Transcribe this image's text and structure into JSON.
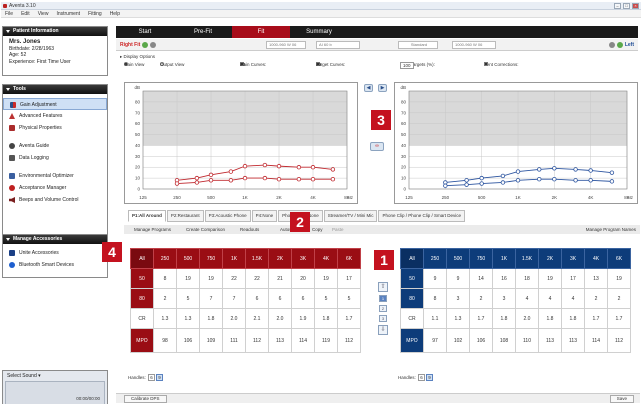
{
  "window": {
    "title": "Aventa 3.10"
  },
  "menu": [
    "File",
    "Edit",
    "View",
    "Instrument",
    "Fitting",
    "Help"
  ],
  "patient": {
    "header": "Patient Information",
    "name": "Mrs. Jones",
    "birthdate": "Birthdate: 2/28/1963",
    "age": "Age: 52",
    "experience": "Experience: First Time User"
  },
  "tools": {
    "header": "Tools",
    "items": [
      "Gain Adjustment",
      "Advanced Features",
      "Physical Properties",
      "Aventa Guide",
      "Data Logging",
      "Environmental Optimizer",
      "Acceptance Manager",
      "Beeps and Volume Control"
    ]
  },
  "accessories": {
    "header": "Manage Accessories",
    "items": [
      "Unite Accessories",
      "Bluetooth Smart Devices"
    ]
  },
  "sound": {
    "label": "Select Sound",
    "time": "00:00/00:00"
  },
  "tabs": [
    "Start",
    "Pre-Fit",
    "Fit",
    "Summary"
  ],
  "ctrl": {
    "right_fit": "Right Fit",
    "left_fit": "Left",
    "field1": "1000-960 W 06",
    "field2": "AI 60 b",
    "field3": "Standard",
    "field4": "1000-960 W 06"
  },
  "display_options": {
    "label": "Display Options",
    "gain_view": "Gain View",
    "output_view": "Output View",
    "gain_curves": "Gain Curves:",
    "gc1": "50",
    "gc2": "80",
    "target_curves": "Target Curves:",
    "tc1": "50",
    "tc2": "80",
    "gain_targets": "Gain Targets (%):",
    "gain_targets_value": "100",
    "vent": "Vent Corrections:"
  },
  "graph": {
    "y_label": "dB",
    "y_ticks": [
      "80",
      "70",
      "60",
      "50",
      "40",
      "30",
      "20",
      "10",
      "0"
    ],
    "x_ticks": [
      "125",
      "250",
      "500",
      "1K",
      "2K",
      "4K",
      "8K"
    ],
    "x_unit": "Hz"
  },
  "chart_data": [
    {
      "type": "line",
      "title": "",
      "ylabel": "dB",
      "xlabel": "Hz",
      "ylim": [
        0,
        90
      ],
      "x": [
        250,
        375,
        500,
        750,
        1000,
        1500,
        2000,
        3000,
        4000,
        6000
      ],
      "series": [
        {
          "values": [
            8,
            10,
            13,
            16,
            21,
            22,
            21,
            20,
            20,
            18
          ],
          "color": "#c0282e"
        },
        {
          "values": [
            5,
            6,
            8,
            8,
            10,
            10,
            9,
            9,
            9,
            9
          ],
          "color": "#c0282e"
        }
      ]
    },
    {
      "type": "line",
      "title": "",
      "ylabel": "dB",
      "xlabel": "Hz",
      "ylim": [
        0,
        90
      ],
      "x": [
        250,
        375,
        500,
        750,
        1000,
        1500,
        2000,
        3000,
        4000,
        6000
      ],
      "series": [
        {
          "values": [
            6,
            8,
            10,
            12,
            16,
            18,
            19,
            18,
            17,
            15
          ],
          "color": "#2d55a0"
        },
        {
          "values": [
            3,
            4,
            5,
            6,
            8,
            9,
            9,
            8,
            8,
            7
          ],
          "color": "#2d55a0"
        }
      ]
    }
  ],
  "program_tabs": [
    "P1:All Around",
    "P2:Restaurant",
    "P3:Acoustic Phone",
    "P4:None",
    "Phone Now: None",
    "Streamer/TV / Mini Mic",
    "Phone Clip / Phone Clip / Smart Device"
  ],
  "toolrow": {
    "manage": "Manage Programs",
    "create": "Create Comparison",
    "readouts": "Readouts",
    "autosave": "Autosave",
    "copy": "Copy",
    "paste": "Paste",
    "manage_names": "Manage Program Names"
  },
  "table": {
    "cols": [
      "All",
      "250",
      "500",
      "750",
      "1K",
      "1.5K",
      "2K",
      "3K",
      "4K",
      "6K"
    ],
    "row_labels": [
      "50",
      "80",
      "CR",
      "MPO"
    ],
    "right": [
      [
        "9",
        "9",
        "14",
        "16",
        "18",
        "19",
        "17",
        "13",
        "19"
      ],
      [
        "8",
        "3",
        "2",
        "3",
        "4",
        "4",
        "4",
        "2",
        "2"
      ],
      [
        "1.1",
        "1.3",
        "1.7",
        "1.8",
        "2.0",
        "1.8",
        "1.8",
        "1.7",
        "1.7"
      ],
      [
        "97",
        "102",
        "106",
        "108",
        "110",
        "113",
        "113",
        "114",
        "112"
      ]
    ],
    "left": [
      [
        "8",
        "19",
        "19",
        "22",
        "22",
        "21",
        "20",
        "19",
        "17"
      ],
      [
        "2",
        "5",
        "7",
        "7",
        "6",
        "6",
        "6",
        "5",
        "5"
      ],
      [
        "1.3",
        "1.3",
        "1.8",
        "2.0",
        "2.1",
        "2.0",
        "1.9",
        "1.8",
        "1.7"
      ],
      [
        "98",
        "106",
        "109",
        "111",
        "112",
        "113",
        "114",
        "119",
        "112"
      ]
    ],
    "handles_label": "Handles:",
    "handles": [
      "6",
      "9"
    ]
  },
  "midnav": {
    "up": "⇧",
    "b1": "1",
    "b2": "2",
    "b3": "3",
    "down": "⇩"
  },
  "callouts": [
    "1",
    "2",
    "3",
    "4"
  ],
  "status": {
    "calibrate": "Calibrate DPS",
    "save": "Save"
  }
}
